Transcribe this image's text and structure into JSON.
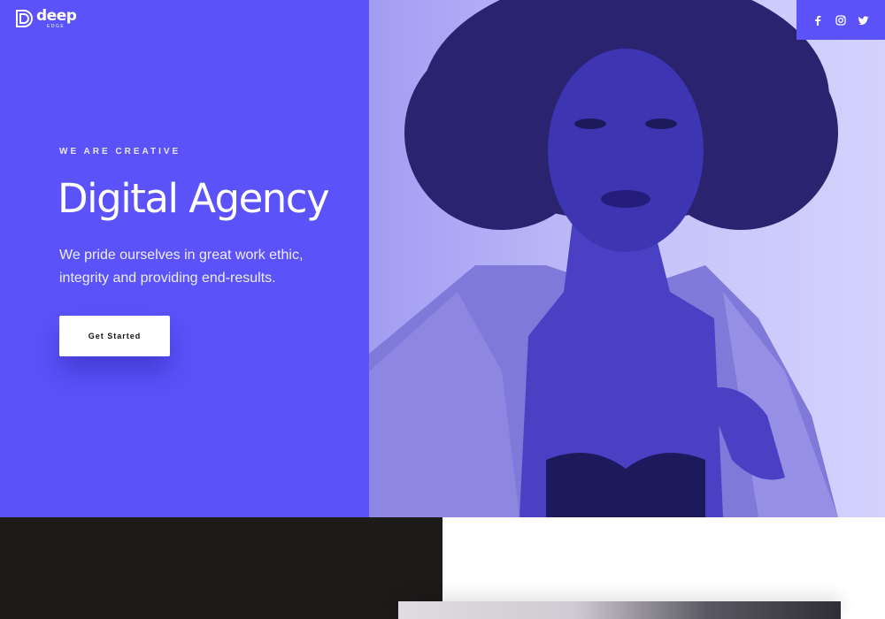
{
  "brand": {
    "name": "deep",
    "subtitle": "EDGE",
    "logo_icon": "d-monogram-icon"
  },
  "hero": {
    "eyebrow": "WE ARE CREATIVE",
    "title": "Digital Agency",
    "description": "We pride ourselves in great work ethic, integrity and providing end-results.",
    "cta_label": "Get Started"
  },
  "social": {
    "icons": [
      "facebook-icon",
      "instagram-icon",
      "twitter-icon"
    ]
  },
  "colors": {
    "accent": "#5b52fa",
    "dark": "#1d1b1a",
    "photo_tint": "#a29df2"
  }
}
